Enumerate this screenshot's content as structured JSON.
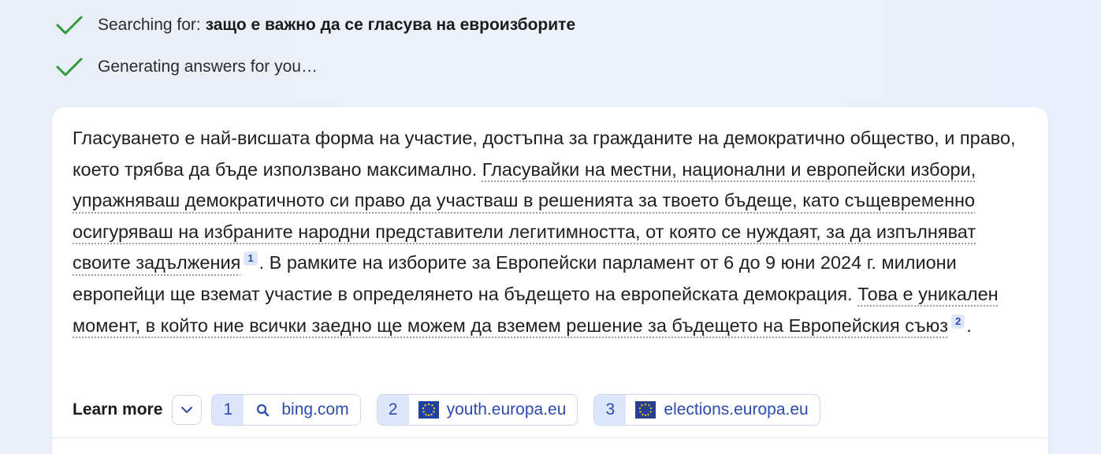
{
  "progress": {
    "search_prefix": "Searching for: ",
    "search_query": "защо е важно да се гласува на евроизборите",
    "generating": "Generating answers for you…"
  },
  "answer": {
    "p1": "Гласуването е най-висшата форма на участие, достъпна за гражданите на демократично общество, и право, което трябва да бъде използвано максимално. ",
    "c1": "Гласувайки на местни, национални и европейски избори, упражняваш демократичното си право да участваш в решенията за твоето бъдеще, като същевременно осигуряваш на избраните народни представители легитимността, от която се нуждаят, за да изпълняват своите задължения",
    "ref1": "1",
    "p2": ". В рамките на изборите за Европейски парламент от 6 до 9 юни 2024 г. милиони европейци ще вземат участие в определянето на бъдещето на европейската демокрация. ",
    "c2": "Това е уникален момент, в който ние всички заедно ще можем да вземем решение за бъдещето на Европейския съюз",
    "ref2": "2",
    "p3": "."
  },
  "learn_more": {
    "label": "Learn more",
    "sources": [
      {
        "num": "1",
        "site": "bing.com",
        "icon": "search-icon"
      },
      {
        "num": "2",
        "site": "youth.europa.eu",
        "icon": "eu-flag-icon"
      },
      {
        "num": "3",
        "site": "elections.europa.eu",
        "icon": "eu-flag-icon"
      }
    ]
  },
  "colors": {
    "check": "#2f9a3a",
    "link": "#2c4bb0",
    "badge_bg": "#dde6fb",
    "eu_flag": "#1f3fa8"
  }
}
